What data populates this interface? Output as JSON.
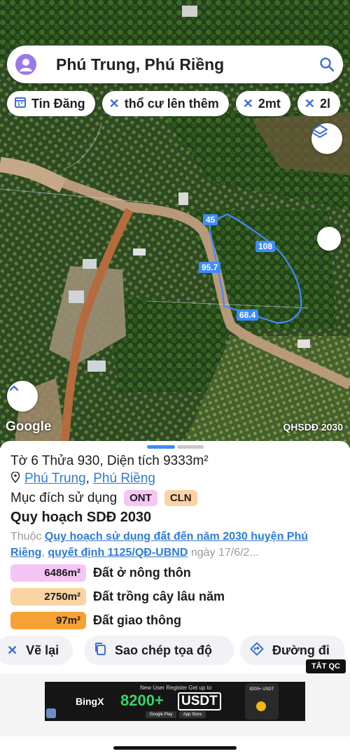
{
  "search": {
    "query": "Phú Trung, Phú Riềng"
  },
  "chips": [
    {
      "icon": "calendar-icon",
      "label": "Tin Đăng"
    },
    {
      "icon": "x-icon",
      "label": "thổ cư lên thêm"
    },
    {
      "icon": "x-icon",
      "label": "2mt"
    },
    {
      "icon": "x-icon",
      "label": "2l"
    }
  ],
  "map": {
    "edge_labels": [
      "45",
      "108",
      "95.7",
      "68.4"
    ],
    "attribution": "Google",
    "layer_name": "QHSDĐ 2030",
    "parcel_outline_color": "#3d8bff"
  },
  "parcel": {
    "title": "Tờ 6 Thửa 930, Diện tích 9333m²",
    "commune": "Phú Trung",
    "separator": ", ",
    "district": "Phú Riềng",
    "purpose_label": "Mục đích sử dụng",
    "purpose_tags": [
      {
        "code": "ONT",
        "color": "#f5c6f5"
      },
      {
        "code": "CLN",
        "color": "#fbd4a4"
      }
    ]
  },
  "plan": {
    "title": "Quy hoạch SDĐ 2030",
    "prefix": "Thuộc ",
    "link1": "Quy hoạch sử dụng đất đến năm 2030 huyện Phú Riềng",
    "comma": ", ",
    "link2": "quyết định 1125/QĐ-UBND",
    "suffix": " ngày 17/6/2..."
  },
  "land_use": [
    {
      "area": "6486m²",
      "label": "Đất ở nông thôn",
      "color": "#f5c6f5"
    },
    {
      "area": "2750m²",
      "label": "Đất trồng cây lâu năm",
      "color": "#fbd4a4"
    },
    {
      "area": "97m²",
      "label": "Đất giao thông",
      "color": "#f6a234"
    }
  ],
  "actions": [
    {
      "icon": "redraw-icon",
      "label": "Vẽ lại"
    },
    {
      "icon": "copy-icon",
      "label": "Sao chép tọa độ"
    },
    {
      "icon": "directions-icon",
      "label": "Đường đi"
    }
  ],
  "ad": {
    "close_label": "TẮT QC",
    "headline": "New User Register Get up to",
    "brand": "BingX",
    "amount": "8200+",
    "currency": "USDT",
    "badge_label": "8200+ USDT",
    "store1": "Google Play",
    "store2": "App Store"
  }
}
